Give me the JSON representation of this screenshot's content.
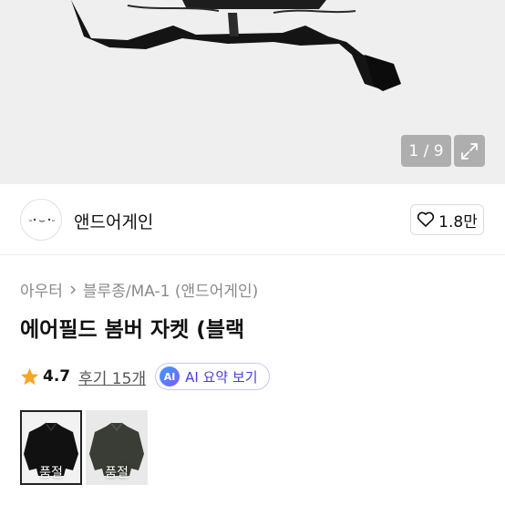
{
  "gallery": {
    "counter": "1 / 9",
    "expand_icon": "expand-icon"
  },
  "seller": {
    "name": "앤드어게인",
    "like_count": "1.8만",
    "like_icon": "heart-icon"
  },
  "product": {
    "breadcrumb": [
      "아우터",
      "블루종/MA-1 (앤드어게인)"
    ],
    "title": "에어필드 봄버 자켓 (블랙",
    "rating": "4.7",
    "reviews": "후기 15개",
    "ai_badge": "AI",
    "ai_summary_label": "AI 요약 보기"
  },
  "options": [
    {
      "label": "품절",
      "selected": true
    },
    {
      "label": "품절",
      "selected": false
    }
  ],
  "colors": {
    "star": "#f5a623",
    "ai_text": "#4b3fd6",
    "ai_border": "#c9c8f2"
  }
}
